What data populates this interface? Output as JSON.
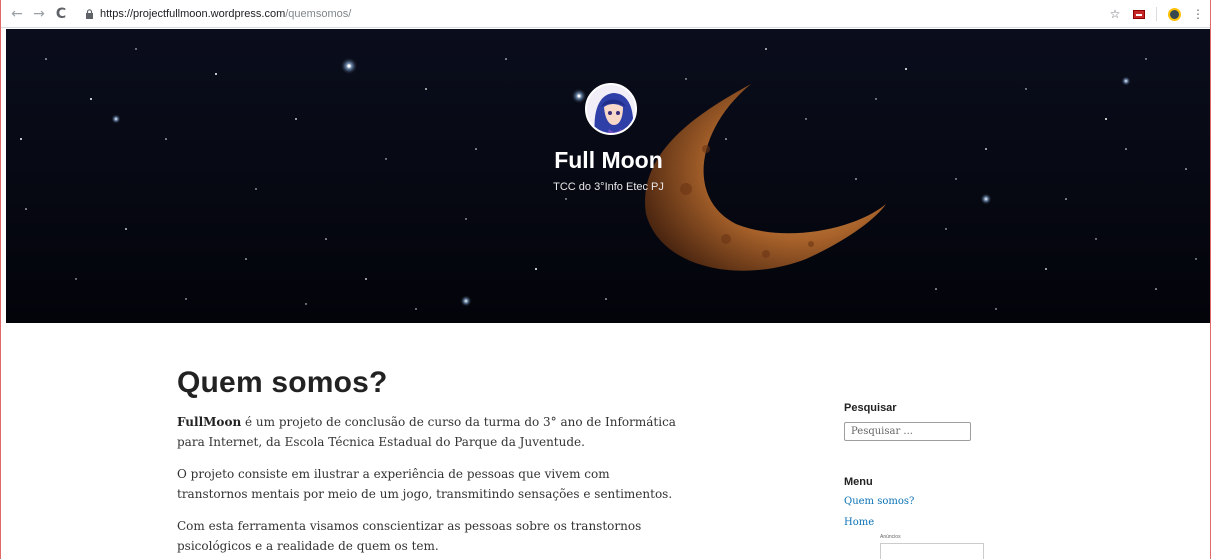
{
  "browser": {
    "url_host": "https://projectfullmoon.wordpress.com",
    "url_path": "/quemsomos/",
    "back_icon": "back-arrow-icon",
    "forward_icon": "forward-arrow-icon",
    "reload_icon": "reload-icon",
    "lock_icon": "lock-icon",
    "star_icon": "star-icon"
  },
  "header": {
    "site_title": "Full Moon",
    "site_description": "TCC do 3°Info Etec PJ"
  },
  "main": {
    "page_title": "Quem somos?",
    "paragraphs": [
      {
        "bold": "FullMoon",
        "text": " é um projeto de conclusão de curso da turma do 3° ano de Informática para Internet, da Escola Técnica Estadual do Parque da Juventude."
      },
      {
        "text": "O projeto consiste em ilustrar a experiência de pessoas que vivem com transtornos mentais por meio de um jogo, transmitindo sensações e sentimentos."
      },
      {
        "text": "Com esta ferramenta visamos conscientizar as pessoas sobre os transtornos psicológicos e a realidade de quem os tem."
      }
    ]
  },
  "sidebar": {
    "search_title": "Pesquisar",
    "search_placeholder": "Pesquisar ...",
    "menu_title": "Menu",
    "menu_items": [
      "Quem somos?",
      "Home"
    ],
    "ads_label": "Anúncios"
  },
  "colors": {
    "link": "#0b72b5",
    "hero_bg": "#05060c"
  }
}
